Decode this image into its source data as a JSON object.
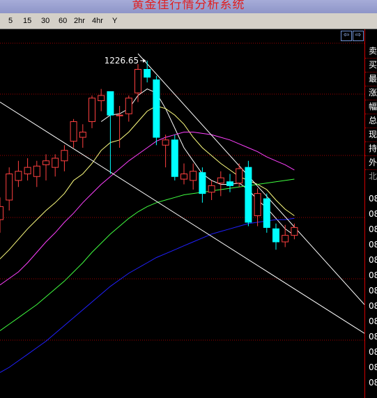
{
  "app": {
    "title": "黄金佳行情分析系统"
  },
  "toolbar": {
    "periods": [
      "5",
      "15",
      "30",
      "60",
      "2hr",
      "4hr",
      "Y"
    ]
  },
  "chart_controls": {
    "left_arrow": "⇦",
    "right_arrow": "⇨"
  },
  "right_panel": {
    "labels": [
      "卖",
      "买",
      "最",
      "涨",
      "幅",
      "总",
      "现",
      "持",
      "外",
      "北"
    ],
    "price_ticks": [
      "08",
      "08",
      "08",
      "08",
      "08",
      "08",
      "08",
      "08",
      "08",
      "08",
      "08",
      "08",
      "08"
    ]
  },
  "colors": {
    "up": "#ff4040",
    "down": "#00ffff",
    "ma_short": "#ffffff",
    "ma_5": "#ffff80",
    "ma_10": "#ff40ff",
    "ma_20": "#40ff40",
    "ma_60": "#2020ff",
    "grid": "#a00000",
    "trend": "#ffffff"
  },
  "chart_data": {
    "type": "candlestick",
    "title": "",
    "annotations": [
      {
        "text": "1226.65",
        "target": "high-candle"
      }
    ],
    "ylim": [
      1080,
      1240
    ],
    "candles": [
      {
        "o": 1105,
        "h": 1122,
        "l": 1095,
        "c": 1115
      },
      {
        "o": 1120,
        "h": 1145,
        "l": 1112,
        "c": 1140
      },
      {
        "o": 1135,
        "h": 1150,
        "l": 1130,
        "c": 1142
      },
      {
        "o": 1140,
        "h": 1152,
        "l": 1135,
        "c": 1145
      },
      {
        "o": 1138,
        "h": 1150,
        "l": 1130,
        "c": 1146
      },
      {
        "o": 1147,
        "h": 1155,
        "l": 1135,
        "c": 1150
      },
      {
        "o": 1145,
        "h": 1155,
        "l": 1138,
        "c": 1152
      },
      {
        "o": 1150,
        "h": 1162,
        "l": 1142,
        "c": 1158
      },
      {
        "o": 1165,
        "h": 1182,
        "l": 1160,
        "c": 1180
      },
      {
        "o": 1168,
        "h": 1178,
        "l": 1160,
        "c": 1172
      },
      {
        "o": 1180,
        "h": 1200,
        "l": 1175,
        "c": 1198
      },
      {
        "o": 1196,
        "h": 1205,
        "l": 1188,
        "c": 1200
      },
      {
        "o": 1203,
        "h": 1203,
        "l": 1140,
        "c": 1185
      },
      {
        "o": 1185,
        "h": 1192,
        "l": 1160,
        "c": 1185
      },
      {
        "o": 1186,
        "h": 1200,
        "l": 1180,
        "c": 1198
      },
      {
        "o": 1202,
        "h": 1224,
        "l": 1195,
        "c": 1220
      },
      {
        "o": 1220,
        "h": 1226.65,
        "l": 1210,
        "c": 1214
      },
      {
        "o": 1212,
        "h": 1215,
        "l": 1162,
        "c": 1168
      },
      {
        "o": 1162,
        "h": 1170,
        "l": 1145,
        "c": 1166
      },
      {
        "o": 1166,
        "h": 1170,
        "l": 1135,
        "c": 1138
      },
      {
        "o": 1136,
        "h": 1148,
        "l": 1132,
        "c": 1140
      },
      {
        "o": 1135,
        "h": 1148,
        "l": 1128,
        "c": 1142
      },
      {
        "o": 1141,
        "h": 1145,
        "l": 1118,
        "c": 1125
      },
      {
        "o": 1126,
        "h": 1135,
        "l": 1120,
        "c": 1131
      },
      {
        "o": 1133,
        "h": 1142,
        "l": 1123,
        "c": 1137
      },
      {
        "o": 1134,
        "h": 1140,
        "l": 1126,
        "c": 1131
      },
      {
        "o": 1133,
        "h": 1148,
        "l": 1130,
        "c": 1144
      },
      {
        "o": 1145,
        "h": 1150,
        "l": 1100,
        "c": 1103
      },
      {
        "o": 1108,
        "h": 1129,
        "l": 1100,
        "c": 1125
      },
      {
        "o": 1121,
        "h": 1125,
        "l": 1095,
        "c": 1099
      },
      {
        "o": 1098,
        "h": 1102,
        "l": 1082,
        "c": 1088
      },
      {
        "o": 1088,
        "h": 1101,
        "l": 1084,
        "c": 1093
      },
      {
        "o": 1093,
        "h": 1102,
        "l": 1090,
        "c": 1099
      }
    ],
    "moving_averages": [
      {
        "name": "MA-a",
        "color": "#ffffff",
        "values": [
          null,
          null,
          null,
          null,
          null,
          null,
          null,
          null,
          null,
          null,
          null,
          1180,
          1185,
          1186,
          1190,
          1200,
          1205,
          1202,
          1190,
          1175,
          1160,
          1150,
          1140,
          1135,
          1132,
          1132,
          1133,
          1128,
          1120,
          1114,
          1106,
          1098,
          1093
        ]
      },
      {
        "name": "MA-b",
        "color": "#ffff80",
        "values": [
          1075,
          1082,
          1090,
          1098,
          1105,
          1112,
          1118,
          1125,
          1135,
          1140,
          1148,
          1158,
          1164,
          1166,
          1172,
          1180,
          1188,
          1192,
          1190,
          1185,
          1178,
          1168,
          1160,
          1154,
          1148,
          1143,
          1138,
          1135,
          1132,
          1128,
          1120,
          1113,
          1108
        ]
      },
      {
        "name": "MA-c",
        "color": "#ff40ff",
        "values": [
          1055,
          1060,
          1065,
          1072,
          1080,
          1088,
          1095,
          1103,
          1110,
          1118,
          1125,
          1132,
          1138,
          1144,
          1150,
          1155,
          1160,
          1165,
          1168,
          1170,
          1172,
          1172,
          1171,
          1170,
          1168,
          1166,
          1163,
          1160,
          1157,
          1153,
          1150,
          1147,
          1143
        ]
      },
      {
        "name": "MA-d",
        "color": "#40ff40",
        "values": [
          1020,
          1025,
          1030,
          1035,
          1040,
          1046,
          1052,
          1058,
          1065,
          1072,
          1080,
          1087,
          1094,
          1100,
          1106,
          1111,
          1115,
          1118,
          1120,
          1122,
          1124,
          1125,
          1126,
          1127,
          1128,
          1129,
          1130,
          1131,
          1132,
          1133,
          1134,
          1135,
          1136
        ]
      },
      {
        "name": "MA-e",
        "color": "#2020ff",
        "values": [
          988,
          992,
          997,
          1002,
          1007,
          1012,
          1018,
          1024,
          1030,
          1036,
          1042,
          1048,
          1054,
          1059,
          1064,
          1068,
          1072,
          1076,
          1079,
          1082,
          1085,
          1088,
          1091,
          1094,
          1096,
          1098,
          1100,
          1102,
          1103,
          1104,
          1105,
          1105,
          1106
        ]
      }
    ]
  }
}
